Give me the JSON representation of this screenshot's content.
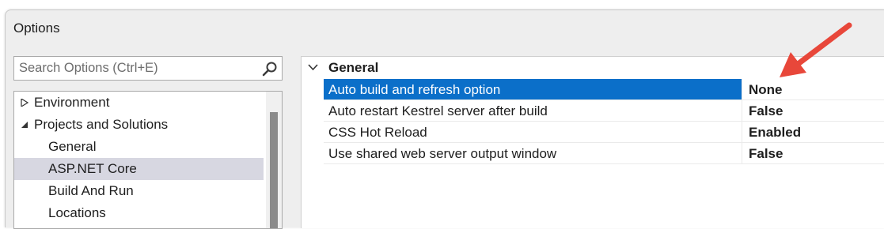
{
  "window": {
    "title": "Options"
  },
  "search": {
    "placeholder": "Search Options (Ctrl+E)",
    "icon": "search-icon"
  },
  "tree": {
    "items": [
      {
        "label": "Environment",
        "expander": "collapsed"
      },
      {
        "label": "Projects and Solutions",
        "expander": "expanded"
      },
      {
        "label": "General"
      },
      {
        "label": "ASP.NET Core",
        "selected": true
      },
      {
        "label": "Build And Run"
      },
      {
        "label": "Locations"
      }
    ]
  },
  "properties": {
    "group": "General",
    "rows": [
      {
        "name": "Auto build and refresh option",
        "value": "None",
        "selected": true
      },
      {
        "name": "Auto restart Kestrel server after build",
        "value": "False"
      },
      {
        "name": "CSS Hot Reload",
        "value": "Enabled"
      },
      {
        "name": "Use shared web server output window",
        "value": "False"
      }
    ]
  },
  "colors": {
    "selection": "#0b6fc9",
    "tree_selection": "#d7d7e1",
    "annotation_arrow": "#e8473a"
  }
}
